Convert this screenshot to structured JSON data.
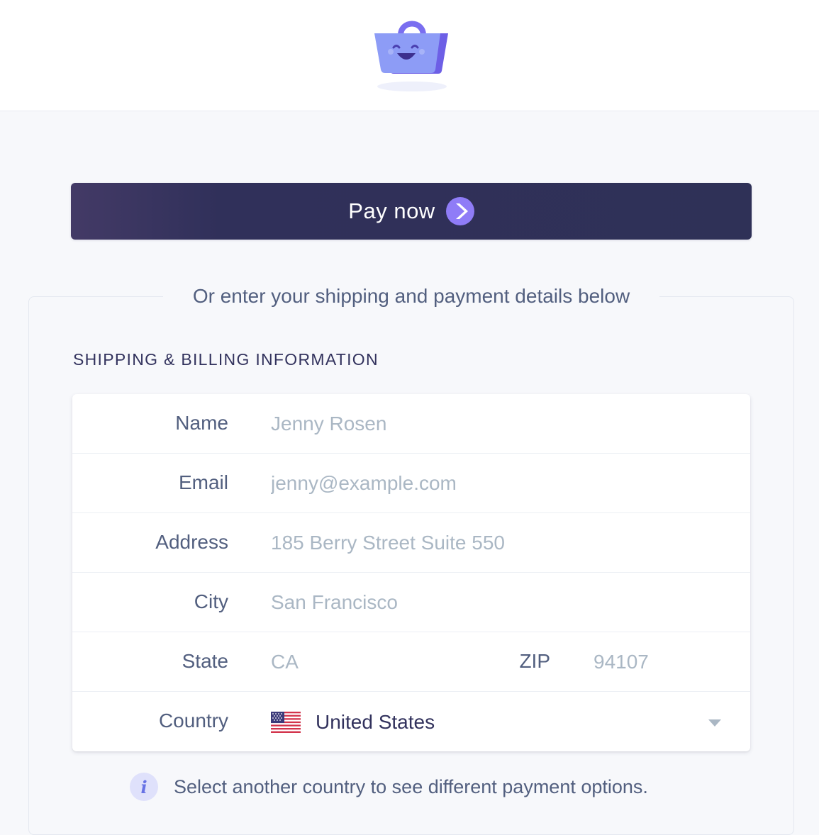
{
  "header": {
    "logo_icon": "smiling-shopping-basket-icon"
  },
  "payment_request": {
    "label": "Pay now",
    "icon": "chevron-right-circle-icon",
    "colors": {
      "button": "#2f3157",
      "icon": "#8f7cf7"
    }
  },
  "form": {
    "legend": "Or enter your shipping and payment details below",
    "section_title": "SHIPPING & BILLING INFORMATION",
    "fields": {
      "name": {
        "label": "Name",
        "placeholder": "Jenny Rosen"
      },
      "email": {
        "label": "Email",
        "placeholder": "jenny@example.com"
      },
      "address": {
        "label": "Address",
        "placeholder": "185 Berry Street Suite 550"
      },
      "city": {
        "label": "City",
        "placeholder": "San Francisco"
      },
      "state": {
        "label": "State",
        "placeholder": "CA"
      },
      "zip": {
        "label": "ZIP",
        "placeholder": "94107"
      },
      "country": {
        "label": "Country",
        "value": "United States",
        "flag_icon": "us-flag-icon"
      }
    },
    "notice": {
      "icon": "info-icon",
      "text": "Select another country to see different payment options."
    }
  }
}
